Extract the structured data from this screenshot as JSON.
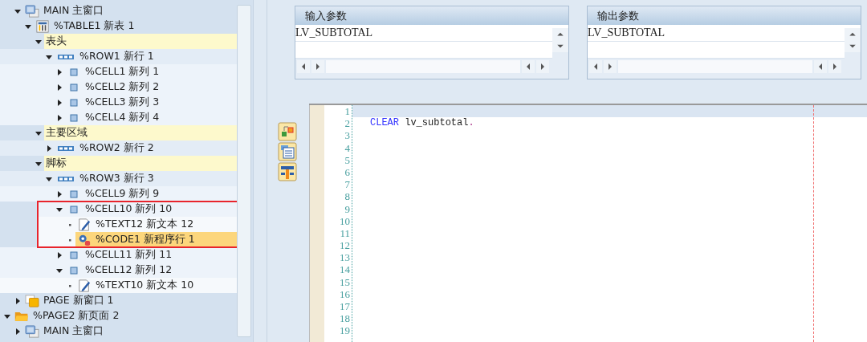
{
  "tree": {
    "continued_children": [
      {
        "label": "MAIN 主窗口",
        "kind": "window",
        "expanded": true,
        "selected": false,
        "children": [
          {
            "label": "%TABLE1 新表 1",
            "kind": "table",
            "expanded": true,
            "selected": false,
            "children": [
              {
                "label": "表头",
                "kind": "section",
                "expanded": true,
                "selected": false,
                "children": [
                  {
                    "label": "%ROW1 新行 1",
                    "kind": "row",
                    "expanded": true,
                    "selected": false,
                    "children": [
                      {
                        "label": "%CELL1 新列 1",
                        "kind": "cell",
                        "expanded": false,
                        "selected": false
                      },
                      {
                        "label": "%CELL2 新列 2",
                        "kind": "cell",
                        "expanded": false,
                        "selected": false
                      },
                      {
                        "label": "%CELL3 新列 3",
                        "kind": "cell",
                        "expanded": false,
                        "selected": false
                      },
                      {
                        "label": "%CELL4 新列 4",
                        "kind": "cell",
                        "expanded": false,
                        "selected": false
                      }
                    ]
                  }
                ]
              },
              {
                "label": "主要区域",
                "kind": "section",
                "expanded": true,
                "selected": false,
                "children": [
                  {
                    "label": "%ROW2 新行 2",
                    "kind": "row",
                    "expanded": false,
                    "selected": false
                  }
                ]
              },
              {
                "label": "脚标",
                "kind": "section",
                "expanded": true,
                "selected": false,
                "children": [
                  {
                    "label": "%ROW3 新行 3",
                    "kind": "row",
                    "expanded": true,
                    "selected": false,
                    "children": [
                      {
                        "label": "%CELL9 新列 9",
                        "kind": "cell",
                        "expanded": false,
                        "selected": false
                      },
                      {
                        "label": "%CELL10 新列 10",
                        "kind": "cell",
                        "expanded": true,
                        "selected": false,
                        "highlighted": true,
                        "children": [
                          {
                            "label": "%TEXT12 新文本 12",
                            "kind": "text",
                            "selected": false
                          },
                          {
                            "label": "%CODE1 新程序行 1",
                            "kind": "code",
                            "selected": true
                          }
                        ]
                      },
                      {
                        "label": "%CELL11 新列 11",
                        "kind": "cell",
                        "expanded": false,
                        "selected": false
                      },
                      {
                        "label": "%CELL12 新列 12",
                        "kind": "cell",
                        "expanded": true,
                        "selected": false,
                        "children": [
                          {
                            "label": "%TEXT10 新文本 10",
                            "kind": "text",
                            "selected": false
                          }
                        ]
                      }
                    ]
                  }
                ]
              }
            ]
          }
        ]
      },
      {
        "label": "PAGE 新窗口 1",
        "kind": "page",
        "expanded": false,
        "selected": false
      }
    ],
    "nodes": [
      {
        "label": "%PAGE2 新页面 2",
        "kind": "folder",
        "expanded": true,
        "selected": false,
        "children": [
          {
            "label": "MAIN 主窗口",
            "kind": "window",
            "expanded": false,
            "selected": false
          }
        ]
      }
    ]
  },
  "params": [
    {
      "title": "输入参数",
      "rows": [
        "LV_SUBTOTAL"
      ]
    },
    {
      "title": "输出参数",
      "rows": [
        "LV_SUBTOTAL"
      ]
    }
  ],
  "editor": {
    "lines": [
      {
        "number": "1",
        "current": true
      },
      {
        "number": "2",
        "current": false,
        "tokens": [
          {
            "kind": "keyword",
            "text": "CLEAR"
          },
          {
            "kind": "plain",
            "text": " lv_subtotal"
          },
          {
            "kind": "punct",
            "text": "."
          }
        ]
      },
      {
        "number": "3",
        "current": false
      },
      {
        "number": "4",
        "current": false
      },
      {
        "number": "5",
        "current": false
      },
      {
        "number": "6",
        "current": false
      },
      {
        "number": "7",
        "current": false
      },
      {
        "number": "8",
        "current": false
      },
      {
        "number": "9",
        "current": false
      },
      {
        "number": "10",
        "current": false
      },
      {
        "number": "11",
        "current": false
      },
      {
        "number": "12",
        "current": false
      },
      {
        "number": "13",
        "current": false
      },
      {
        "number": "14",
        "current": false
      },
      {
        "number": "15",
        "current": false
      },
      {
        "number": "16",
        "current": false
      },
      {
        "number": "17",
        "current": false
      },
      {
        "number": "18",
        "current": false
      },
      {
        "number": "19",
        "current": false
      }
    ]
  }
}
